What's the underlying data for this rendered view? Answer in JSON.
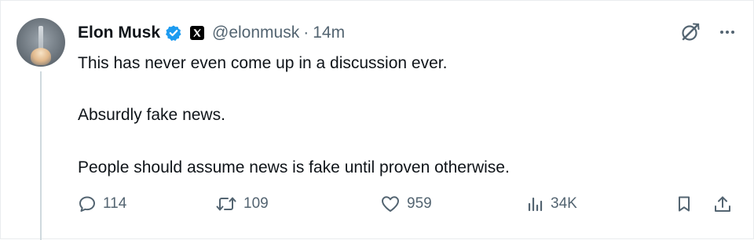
{
  "tweet": {
    "author_name": "Elon Musk",
    "handle": "@elonmusk",
    "separator": "·",
    "time": "14m",
    "paragraphs": [
      "This has never even come up in a discussion ever.",
      "Absurdly fake news.",
      "People should assume news is fake until proven otherwise."
    ]
  },
  "stats": {
    "replies": "114",
    "retweets": "109",
    "likes": "959",
    "views": "34K"
  },
  "icons": {
    "verified": "verified-badge-icon",
    "affiliate": "x-logo-icon",
    "grok": "grok-icon",
    "more": "more-icon",
    "reply": "reply-icon",
    "retweet": "retweet-icon",
    "like": "heart-icon",
    "views": "views-icon",
    "bookmark": "bookmark-icon",
    "share": "share-icon"
  },
  "colors": {
    "text": "#0f1419",
    "secondary": "#536471",
    "verified": "#1d9bf0",
    "thread_line": "#cfd9de"
  }
}
